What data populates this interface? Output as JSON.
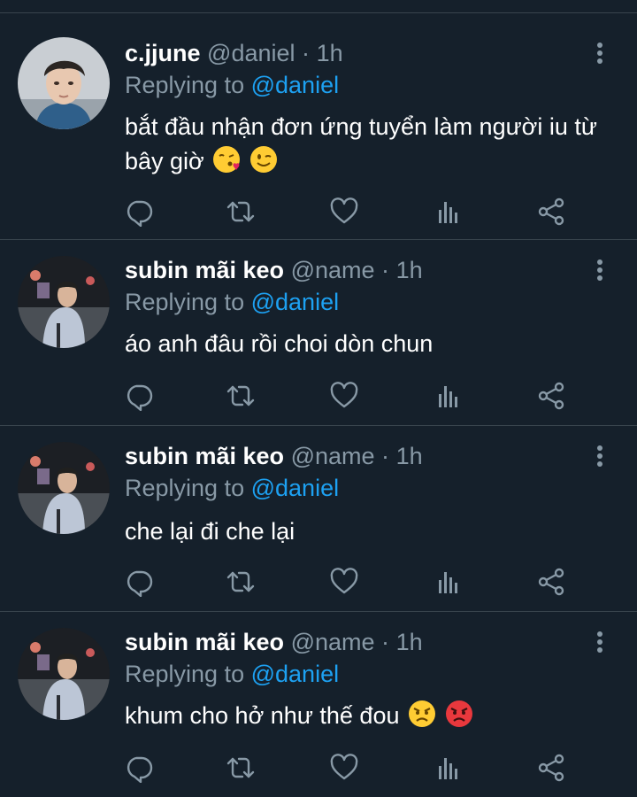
{
  "tweets": [
    {
      "name": "c.jjune",
      "handle": "@daniel",
      "separator": "·",
      "time": "1h",
      "replying_prefix": "Replying to",
      "replying_to": "@daniel",
      "text": "bắt đầu nhận đơn ứng tuyển làm người iu từ bây giờ",
      "emojis": [
        "face-blowing-kiss-emoji",
        "winking-face-emoji"
      ]
    },
    {
      "name": "subin mãi keo",
      "handle": "@name",
      "separator": "·",
      "time": "1h",
      "replying_prefix": "Replying to",
      "replying_to": "@daniel",
      "text": "áo anh đâu rồi choi dòn chun",
      "emojis": []
    },
    {
      "name": "subin mãi keo",
      "handle": "@name",
      "separator": "·",
      "time": "1h",
      "replying_prefix": "Replying to",
      "replying_to": "@daniel",
      "text": "che lại đi che lại",
      "emojis": []
    },
    {
      "name": "subin mãi keo",
      "handle": "@name",
      "separator": "·",
      "time": "1h",
      "replying_prefix": "Replying to",
      "replying_to": "@daniel",
      "text": "khum cho hở như thế đou",
      "emojis": [
        "angry-face-emoji",
        "pouting-face-emoji"
      ]
    }
  ],
  "action_icons": [
    "reply-icon",
    "retweet-icon",
    "like-icon",
    "analytics-icon",
    "share-icon"
  ],
  "colors": {
    "background": "#15202b",
    "divider": "#38444d",
    "secondary_text": "#8899a6",
    "mention": "#1da1f2",
    "primary_text": "#ffffff"
  }
}
